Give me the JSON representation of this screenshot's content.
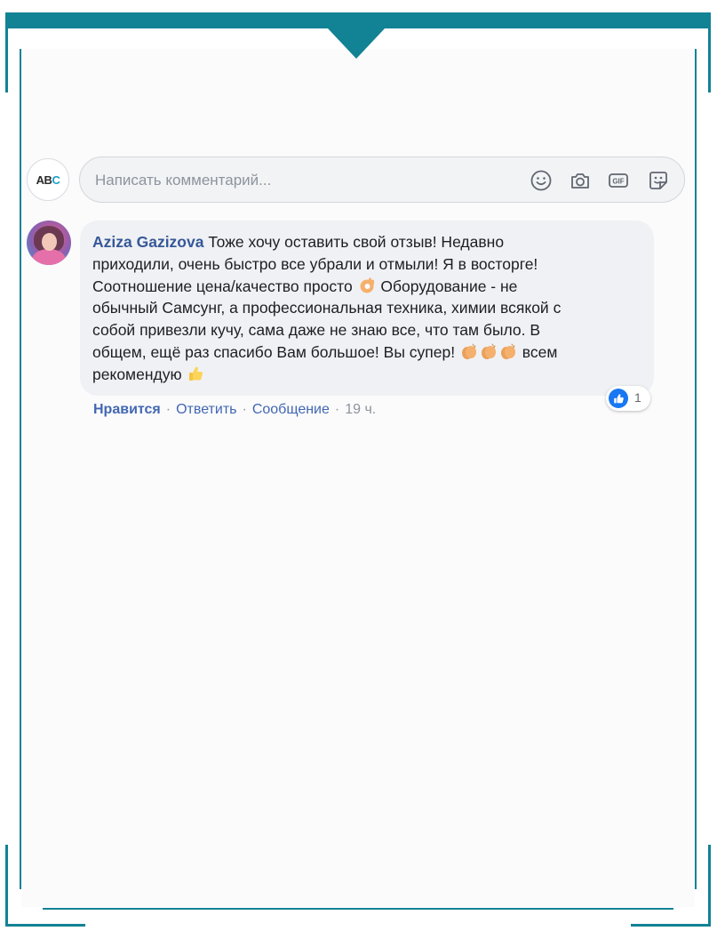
{
  "composer": {
    "page_logo": "AB",
    "page_logo_accent": "C",
    "placeholder": "Написать комментарий...",
    "icons": [
      "smile-icon",
      "camera-icon",
      "gif-icon",
      "sticker-icon"
    ]
  },
  "comment": {
    "author": "Aziza Gazizova",
    "text_part1": " Тоже хочу оставить свой отзыв! Недавно\nприходили, очень быстро все убрали и отмыли! Я в восторге!\nСоотношение цена/качество просто ",
    "emoji1": "ok-hand-emoji",
    "text_part2": " Оборудование - не\nобычный Самсунг, а профессиональная техника, химии всякой с\nсобой привезли кучу, сама даже не знаю все, что там было. В\nобщем, ещё раз спасибо Вам большое! Вы супер! ",
    "emoji_clap": "clapping-hands-emoji",
    "emoji_clap_count": 3,
    "text_part3": " всем\nрекомендую ",
    "emoji2": "thumbs-up-emoji",
    "reactions": {
      "type": "like",
      "count": "1"
    },
    "actions": {
      "like": "Нравится",
      "reply": "Ответить",
      "message": "Сообщение",
      "separator": "·",
      "time": "19 ч."
    }
  },
  "colors": {
    "frame": "#128295",
    "link": "#4267b2",
    "author": "#365899",
    "bubble": "#f0f1f4",
    "like_blue": "#1877f2"
  }
}
